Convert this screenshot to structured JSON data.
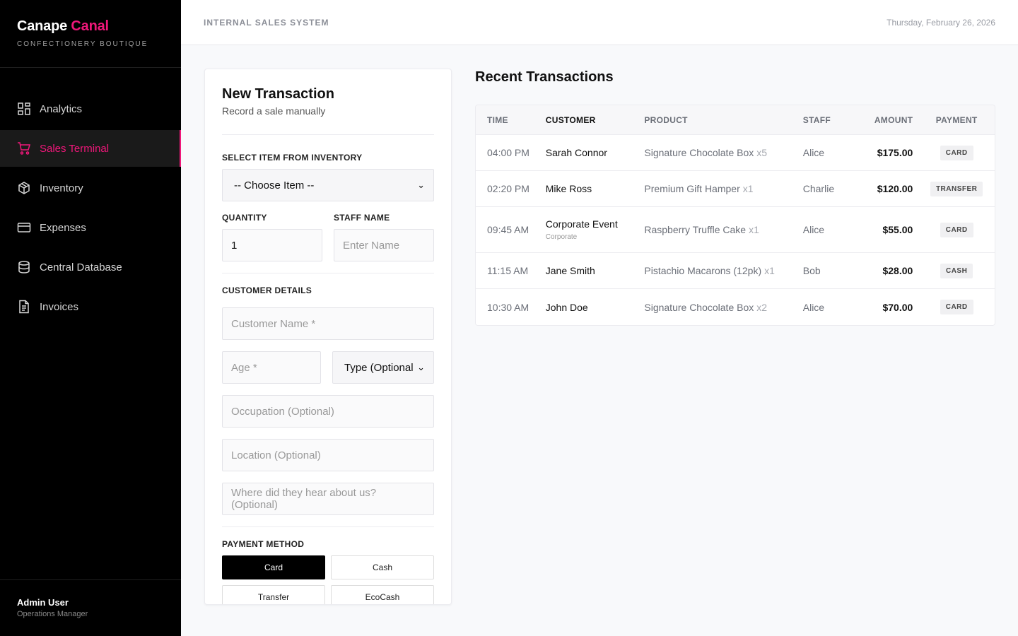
{
  "brand": {
    "name": "Canape",
    "accent": "Canal",
    "tagline": "CONFECTIONERY BOUTIQUE",
    "accent_color": "#f0177a"
  },
  "nav": [
    {
      "label": "Analytics",
      "icon": "grid-icon"
    },
    {
      "label": "Sales Terminal",
      "icon": "cart-icon",
      "active": true
    },
    {
      "label": "Inventory",
      "icon": "box-icon"
    },
    {
      "label": "Expenses",
      "icon": "card-icon"
    },
    {
      "label": "Central Database",
      "icon": "database-icon"
    },
    {
      "label": "Invoices",
      "icon": "document-icon"
    }
  ],
  "user": {
    "name": "Admin User",
    "role": "Operations Manager"
  },
  "header": {
    "title": "INTERNAL SALES SYSTEM",
    "date": "Thursday, February 26, 2026"
  },
  "form": {
    "title": "New Transaction",
    "subtitle": "Record a sale manually",
    "item_label": "SELECT ITEM FROM INVENTORY",
    "item_selected": "-- Choose Item --",
    "quantity_label": "QUANTITY",
    "quantity_value": "1",
    "staff_label": "STAFF NAME",
    "staff_placeholder": "Enter Name",
    "customer_label": "CUSTOMER DETAILS",
    "customer_name_placeholder": "Customer Name *",
    "age_placeholder": "Age *",
    "type_selected": "Type (Optional",
    "occupation_placeholder": "Occupation (Optional)",
    "location_placeholder": "Location (Optional)",
    "referral_placeholder": "Where did they hear about us? (Optional)",
    "payment_label": "PAYMENT METHOD",
    "payment_options": [
      "Card",
      "Cash",
      "Transfer",
      "EcoCash"
    ],
    "payment_selected": "Card"
  },
  "transactions": {
    "title": "Recent Transactions",
    "columns": [
      "TIME",
      "CUSTOMER",
      "PRODUCT",
      "STAFF",
      "AMOUNT",
      "PAYMENT"
    ],
    "rows": [
      {
        "time": "04:00 PM",
        "customer": "Sarah Connor",
        "customer_sub": "",
        "product": "Signature Chocolate Box",
        "qty": "x5",
        "staff": "Alice",
        "amount": "$175.00",
        "payment": "CARD"
      },
      {
        "time": "02:20 PM",
        "customer": "Mike Ross",
        "customer_sub": "",
        "product": "Premium Gift Hamper",
        "qty": "x1",
        "staff": "Charlie",
        "amount": "$120.00",
        "payment": "TRANSFER"
      },
      {
        "time": "09:45 AM",
        "customer": "Corporate Event",
        "customer_sub": "Corporate",
        "product": "Raspberry Truffle Cake",
        "qty": "x1",
        "staff": "Alice",
        "amount": "$55.00",
        "payment": "CARD"
      },
      {
        "time": "11:15 AM",
        "customer": "Jane Smith",
        "customer_sub": "",
        "product": "Pistachio Macarons (12pk)",
        "qty": "x1",
        "staff": "Bob",
        "amount": "$28.00",
        "payment": "CASH"
      },
      {
        "time": "10:30 AM",
        "customer": "John Doe",
        "customer_sub": "",
        "product": "Signature Chocolate Box",
        "qty": "x2",
        "staff": "Alice",
        "amount": "$70.00",
        "payment": "CARD"
      }
    ]
  }
}
